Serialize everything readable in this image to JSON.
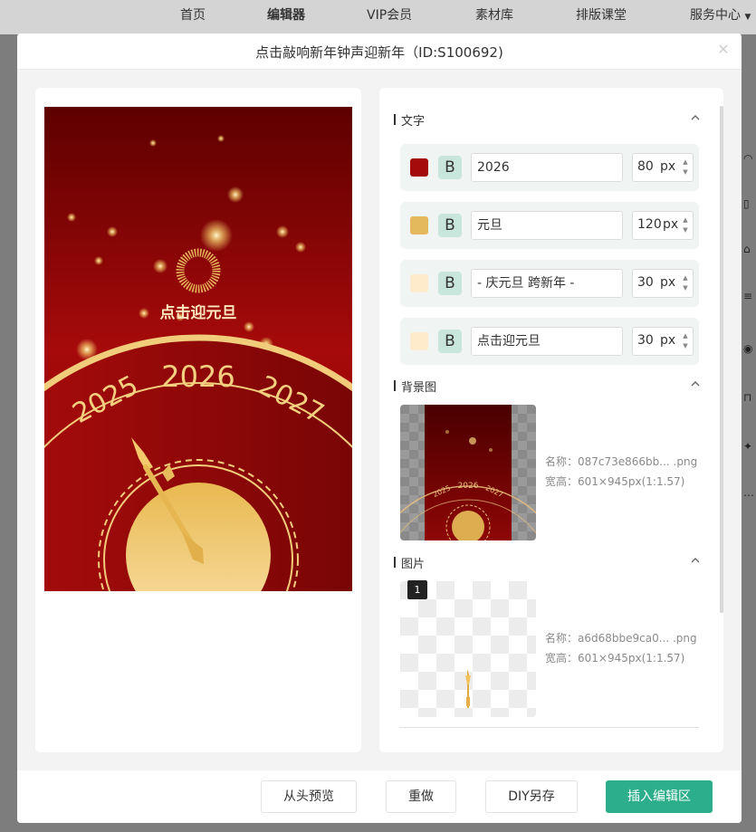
{
  "topnav": {
    "items": [
      "首页",
      "编辑器",
      "VIP会员",
      "素材库",
      "排版课堂",
      "服务中心"
    ]
  },
  "modal": {
    "title": "点击敲响新年钟声迎新年（ID:S100692)",
    "close_icon": "close-icon"
  },
  "poster": {
    "heading": "点击迎元旦",
    "year_left": "2025",
    "year_center": "2026",
    "year_right": "2027"
  },
  "sections": {
    "text": {
      "label": "文字",
      "rows": [
        {
          "color": "#a40c0c",
          "bold": "B",
          "value": "2026",
          "size": "80",
          "unit": "px"
        },
        {
          "color": "#e4b85c",
          "bold": "B",
          "value": "元旦",
          "size": "120",
          "unit": "px"
        },
        {
          "color": "#fdebcb",
          "bold": "B",
          "value": "- 庆元旦 跨新年 -",
          "size": "30",
          "unit": "px"
        },
        {
          "color": "#fdebcb",
          "bold": "B",
          "value": "点击迎元旦",
          "size": "30",
          "unit": "px"
        }
      ]
    },
    "background": {
      "label": "背景图",
      "name_line": "名称：087c73e866bb...  .png",
      "size_line": "宽高：601×945px(1:1.57)"
    },
    "image": {
      "label": "图片",
      "badge": "1",
      "name_line": "名称：a6d68bbe9ca0...  .png",
      "size_line": "宽高：601×945px(1:1.57)"
    }
  },
  "footer": {
    "preview": "从头预览",
    "redo": "重做",
    "save_as": "DIY另存",
    "insert": "插入编辑区"
  },
  "colors": {
    "accent": "#2dae8a",
    "poster_red": "#a40c0c",
    "gold": "#e4b85c"
  }
}
